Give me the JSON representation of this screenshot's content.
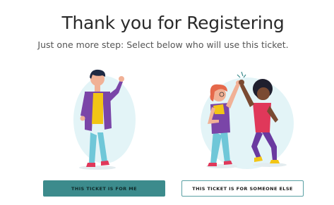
{
  "heading": {
    "title": "Thank you for Registering",
    "subtitle": "Just one more step: Select below who will use this ticket."
  },
  "options": {
    "me_label": "THIS TICKET IS FOR ME",
    "else_label": "THIS TICKET IS FOR SOMEONE ELSE"
  },
  "colors": {
    "primary": "#3c8b8c",
    "outline": "#5aa0a4",
    "blob": "#e3f4f7"
  }
}
